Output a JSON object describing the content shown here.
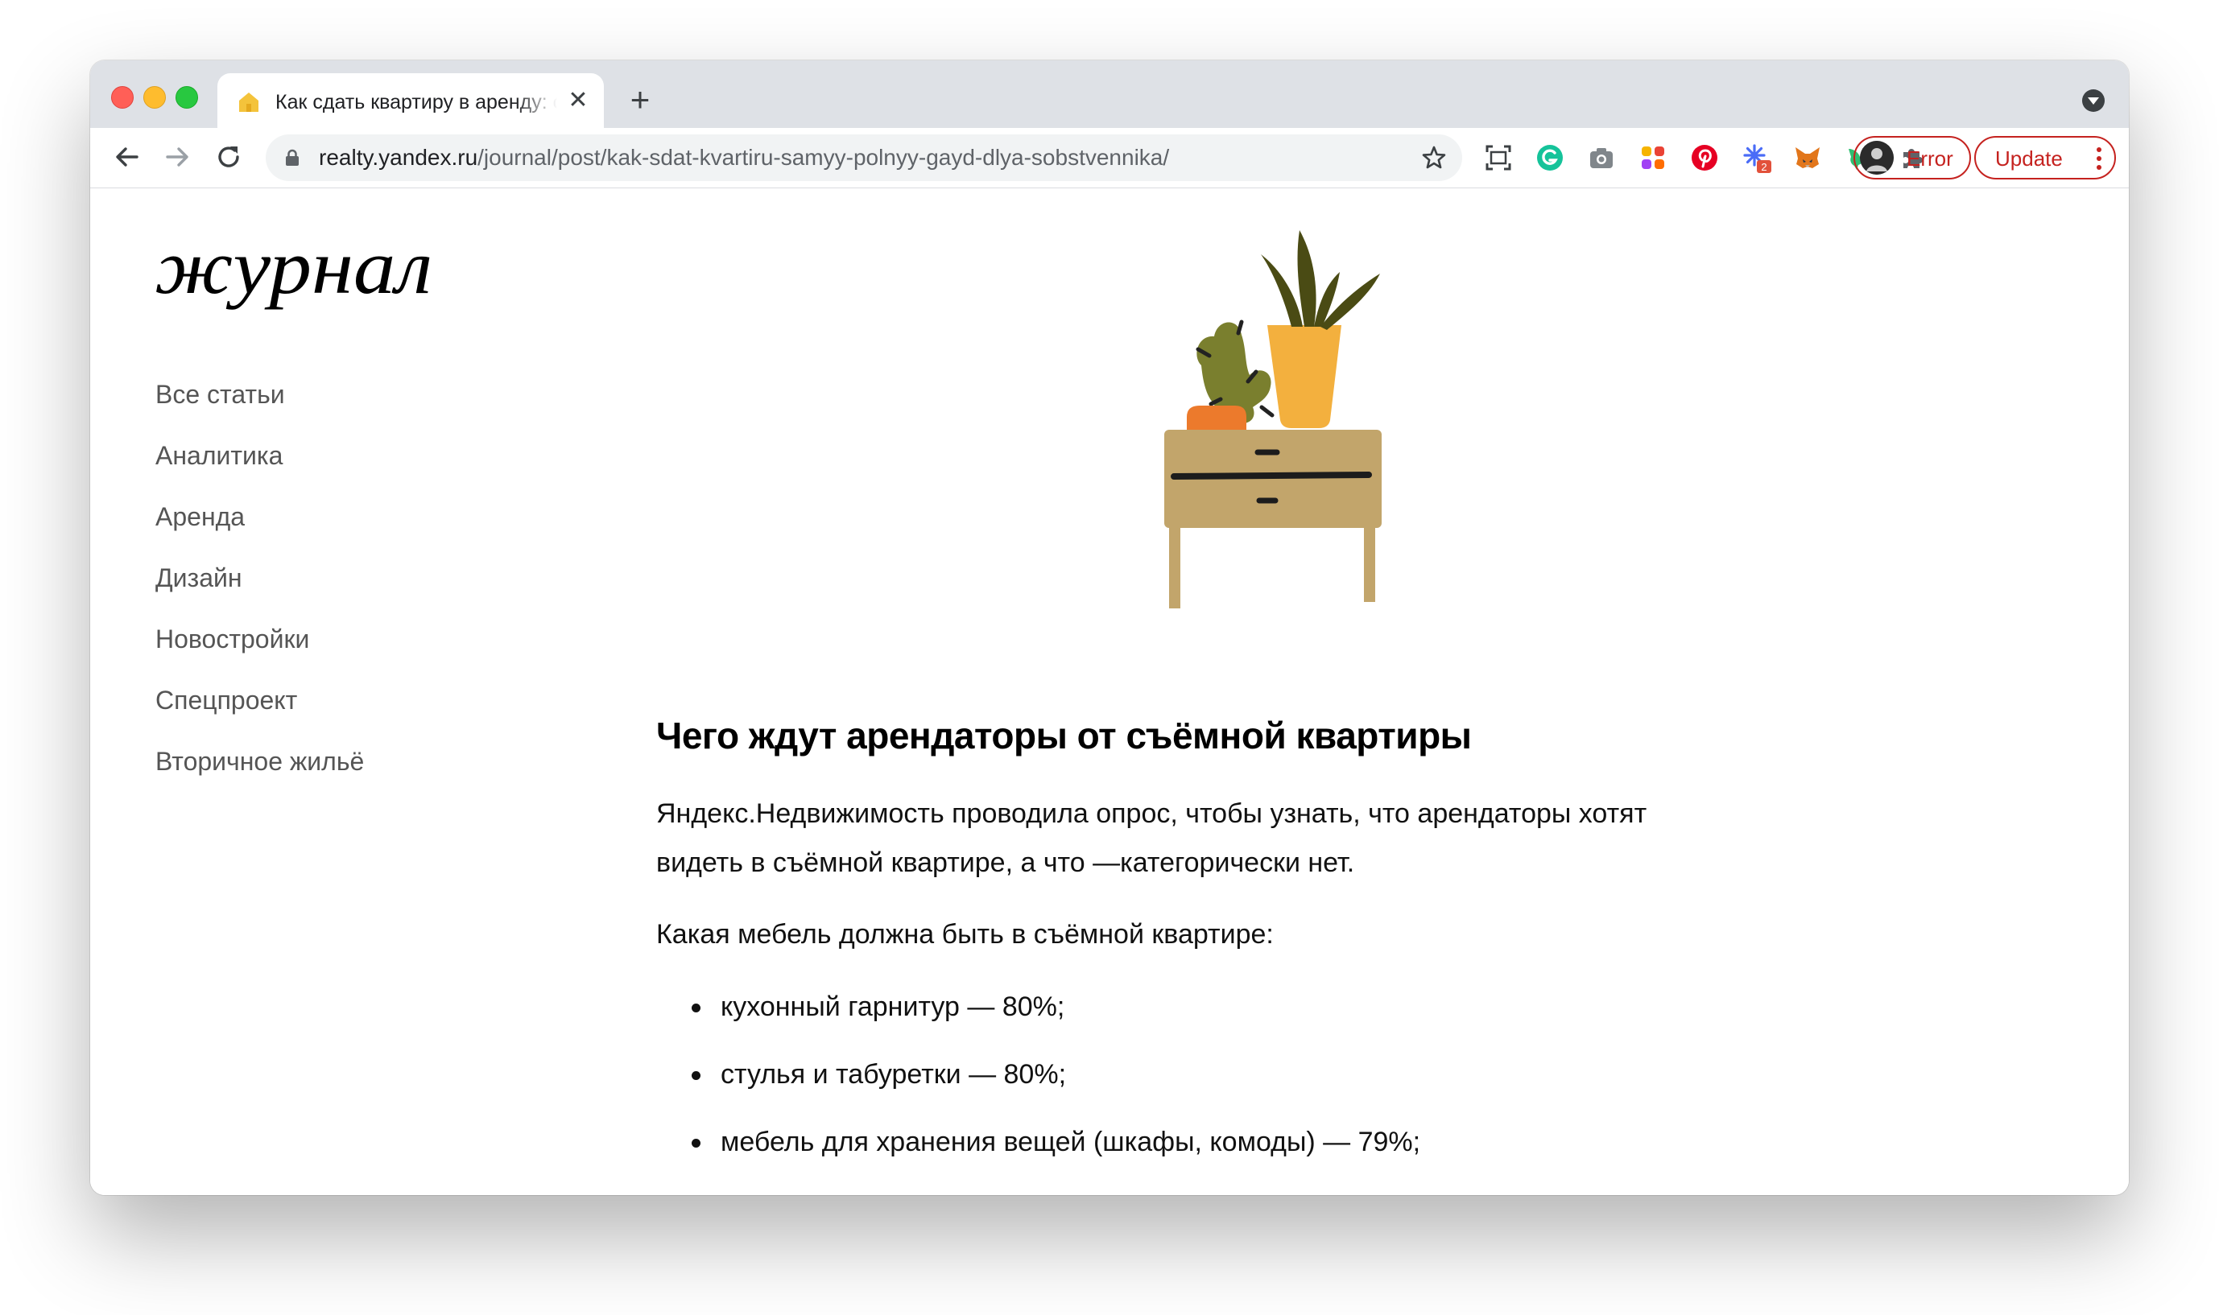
{
  "browser": {
    "tab": {
      "title": "Как сдать квартиру в аренду: самый полный гайд для собственника",
      "close_glyph": "✕"
    },
    "new_tab_glyph": "+",
    "address": {
      "host": "realty.yandex.ru",
      "path": "/journal/post/kak-sdat-kvartiru-samyy-polnyy-gayd-dlya-sobstvennika/"
    },
    "profile_button": {
      "label": "Error"
    },
    "update_button": {
      "label": "Update"
    },
    "extension_badge": "2",
    "icons": [
      "back-arrow-icon",
      "forward-arrow-icon",
      "reload-icon",
      "lock-icon",
      "bookmark-star-icon",
      "screenshot-icon",
      "grammarly-icon",
      "camera-icon",
      "apps-icon",
      "pinterest-icon",
      "extension-asterisk-icon",
      "metamask-fox-icon",
      "bird-icon",
      "puzzle-extensions-icon"
    ]
  },
  "sidebar": {
    "logo_text": "журнал",
    "nav": [
      "Все статьи",
      "Аналитика",
      "Аренда",
      "Дизайн",
      "Новостройки",
      "Спецпроект",
      "Вторичное жильё"
    ]
  },
  "article": {
    "heading": "Чего ждут арендаторы от съёмной квартиры",
    "paragraph1": "Яндекс.Недвижимость проводила опрос, чтобы узнать, что арендаторы хотят видеть в съёмной квартире, а что —категорически нет.",
    "paragraph2": "Какая мебель должна быть в съёмной квартире:",
    "list": [
      "кухонный гарнитур — 80%;",
      "стулья и табуретки — 80%;",
      "мебель для хранения вещей (шкафы, комоды) — 79%;"
    ]
  },
  "colors": {
    "tabstrip": "#dee1e6",
    "accent_red": "#c5221f",
    "text": "#111111",
    "menu_text": "#555555"
  }
}
